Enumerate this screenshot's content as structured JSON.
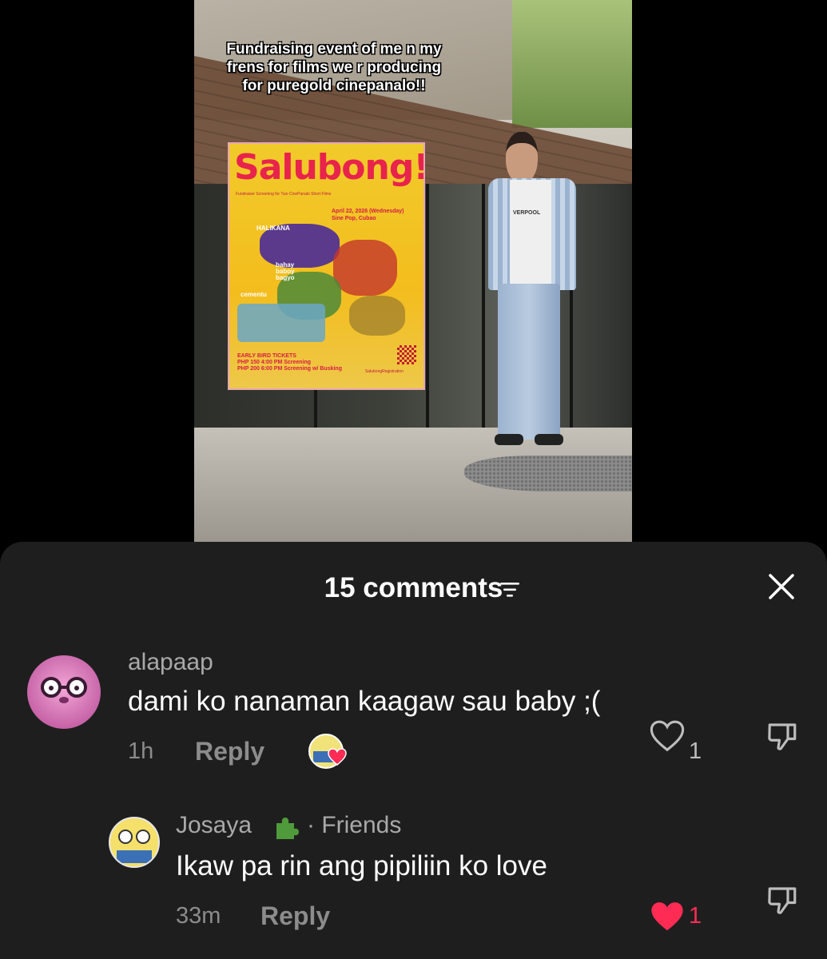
{
  "video": {
    "caption": "Fundraising event of me n my frens for films we r producing for puregold cinepanalo!!",
    "poster": {
      "title": "Salubong!",
      "subtitle": "Fundraiser Screening for Two CinePanalo Short Films",
      "date_line1": "April 22, 2026 (Wednesday)",
      "date_line2": "Sine Pop, Cubao",
      "film1": "HALIKANA",
      "film2": "bahay baboy bagyo",
      "film3": "cementu",
      "tickets_title": "EARLY BIRD TICKETS",
      "ticket1": "PHP 150  4:00 PM Screening",
      "ticket2": "PHP 200  6:00 PM Screening w/ Busking",
      "registration": "SalubongRegistration"
    },
    "shirt_text": "VERPOOL"
  },
  "comments_sheet": {
    "title": "15 comments",
    "comments": [
      {
        "username": "alapaap",
        "text": "dami ko nanaman kaagaw sau baby ;(",
        "time": "1h",
        "reply_label": "Reply",
        "likes": "1",
        "liked": false
      },
      {
        "username": "Josaya",
        "badge": "· Friends",
        "text": "Ikaw pa rin ang pipiliin ko love",
        "time": "33m",
        "reply_label": "Reply",
        "likes": "1",
        "liked": true
      }
    ]
  },
  "colors": {
    "sheet_bg": "#1e1e1e",
    "like_red": "#fe2c55",
    "muted": "#8c8c8c"
  }
}
